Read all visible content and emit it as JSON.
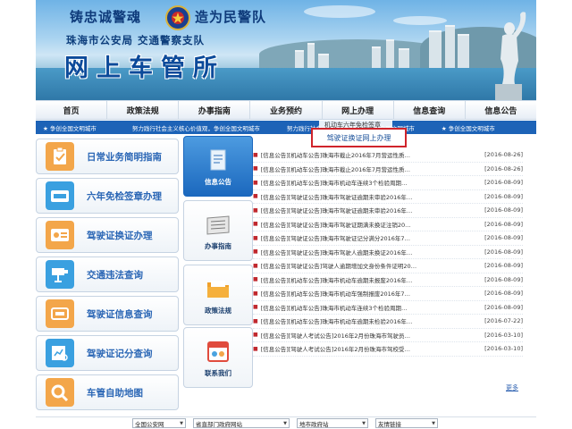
{
  "header": {
    "slogan_left": "铸忠诚警魂",
    "slogan_right": "造为民警队",
    "department": "珠海市公安局 交通警察支队",
    "site_title": "网上车管所"
  },
  "nav": {
    "items": [
      {
        "label": "首页"
      },
      {
        "label": "政策法规"
      },
      {
        "label": "办事指南"
      },
      {
        "label": "业务预约"
      },
      {
        "label": "网上办理"
      },
      {
        "label": "信息查询"
      },
      {
        "label": "信息公告"
      }
    ]
  },
  "dropdown": {
    "item_1": "机动车六年免检签章",
    "item_2": "驾驶证换证网上办理"
  },
  "ticker": {
    "items": [
      "★ 争创全国文明城市",
      "努力践行社会主义核心价值观，争创全国文明城市",
      "努力践行社会主义核心价值观，争创全国文明城市",
      "★ 争创全国文明城市"
    ]
  },
  "left_menu": [
    {
      "label": "日常业务简明指南",
      "icon": "clipboard-check-icon",
      "color": "#f3a64a"
    },
    {
      "label": "六年免检签章办理",
      "icon": "id-card-icon",
      "color": "#3aa0e0"
    },
    {
      "label": "驾驶证换证办理",
      "icon": "license-card-icon",
      "color": "#f3a64a"
    },
    {
      "label": "交通违法查询",
      "icon": "camera-icon",
      "color": "#3aa0e0"
    },
    {
      "label": "驾驶证信息查询",
      "icon": "expiry-icon",
      "color": "#f3a64a"
    },
    {
      "label": "驾驶证记分查询",
      "icon": "chart-search-icon",
      "color": "#3aa0e0"
    },
    {
      "label": "车管自助地图",
      "icon": "magnifier-icon",
      "color": "#f3a64a"
    }
  ],
  "tabs": [
    {
      "label": "信息公告",
      "icon": "document-icon",
      "active": true
    },
    {
      "label": "办事指南",
      "icon": "newspaper-icon",
      "active": false
    },
    {
      "label": "政策法规",
      "icon": "folder-icon",
      "active": false
    },
    {
      "label": "联系我们",
      "icon": "calendar-icon",
      "active": false
    }
  ],
  "news": [
    {
      "title": "[信息公告][机动车公告]珠海市截止2016年7月营运性质…",
      "date": "[2016-08-26]"
    },
    {
      "title": "[信息公告][机动车公告]珠海市截止2016年7月营运性质…",
      "date": "[2016-08-26]"
    },
    {
      "title": "[信息公告][机动车公告]珠海市机动车连续3个检验周期…",
      "date": "[2016-08-09]"
    },
    {
      "title": "[信息公告][驾驶证公告]珠海市驾驶证逾期未审验2016年…",
      "date": "[2016-08-09]"
    },
    {
      "title": "[信息公告][驾驶证公告]珠海市驾驶证逾期未审验2016年…",
      "date": "[2016-08-09]"
    },
    {
      "title": "[信息公告][驾驶证公告]珠海市驾驶证期满未换证注销20…",
      "date": "[2016-08-09]"
    },
    {
      "title": "[信息公告][驾驶证公告]珠海市驾驶证记分满分2016年7…",
      "date": "[2016-08-09]"
    },
    {
      "title": "[信息公告][驾驶证公告]珠海市驾驶人逾期未换证2016年…",
      "date": "[2016-08-09]"
    },
    {
      "title": "[信息公告][驾驶证公告]驾驶人逾期增加文身份条件证明20…",
      "date": "[2016-08-09]"
    },
    {
      "title": "[信息公告][机动车公告]珠海市机动车逾期未报废2016年…",
      "date": "[2016-08-09]"
    },
    {
      "title": "[信息公告][机动车公告]珠海市机动车强制报废2016年7…",
      "date": "[2016-08-09]"
    },
    {
      "title": "[信息公告][机动车公告]珠海市机动车连续3个检验周期…",
      "date": "[2016-08-09]"
    },
    {
      "title": "[信息公告][机动车公告]珠海市机动车逾期未检验2016年…",
      "date": "[2016-07-22]"
    },
    {
      "title": "[信息公告][驾驶人考试公告]2016年2月份珠海市驾驶员…",
      "date": "[2016-03-10]"
    },
    {
      "title": "[信息公告][驾驶人考试公告]2016年2月份珠海市驾校受…",
      "date": "[2016-03-10]"
    }
  ],
  "more_label": "更多",
  "footer": {
    "selects": [
      {
        "value": "全国公安网"
      },
      {
        "value": "省直部门政府网站"
      },
      {
        "value": "地市政府站"
      },
      {
        "value": "友情链接"
      }
    ]
  },
  "colors": {
    "accent_blue": "#1d63b7",
    "highlight_red": "#d0242b",
    "menu_text": "#2a66b5"
  }
}
